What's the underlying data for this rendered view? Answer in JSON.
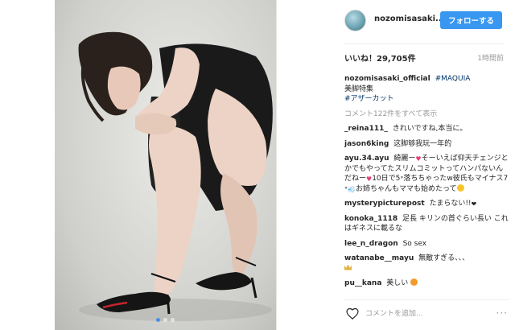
{
  "post": {
    "username": "nozomisasaki...",
    "follow_label": "フォローする",
    "likes": "いいね！29,705件",
    "time_ago": "1時間前",
    "caption": {
      "username": "nozomisasaki_official",
      "hashtag1": "#MAQUIA",
      "line2": "美脚特集",
      "hashtag2": "#アザーカット"
    },
    "view_all_comments": "コメント122件をすべて表示",
    "comments": [
      {
        "user": "_reina111_",
        "text": "きれいですね,本当に。"
      },
      {
        "user": "jason6king",
        "text": "这脚够我玩一年的"
      },
      {
        "user": "ayu.34.ayu",
        "text_a": "綺麗ー",
        "text_b": "そーいえば仰天チェンジとかでもやってたスリムコミットってハンパないんだねー",
        "text_c": "10日で5",
        "text_d": "落ちちゃったw彼氏もマイナス7",
        "text_e": "お姉ちゃんもママも始めたって"
      },
      {
        "user": "mysterypicturepost",
        "text_a": "たまらない!!"
      },
      {
        "user": "konoka_1118",
        "text": "足長 キリンの首ぐらい長い これはギネスに載るな"
      },
      {
        "user": "lee_n_dragon",
        "text": "So sex"
      },
      {
        "user": "watanabe__mayu",
        "text": "無敵すぎる、、、"
      },
      {
        "user": "pu__kana",
        "text": "美しい"
      }
    ],
    "comment_placeholder": "コメントを追加...",
    "carousel": {
      "count": 3,
      "active_index": 0
    }
  },
  "icons": {
    "like": "heart-outline-icon",
    "more": "more-options-icon"
  },
  "colors": {
    "follow_button": "#3897f0",
    "hashtag": "#003569",
    "muted": "#999999"
  }
}
